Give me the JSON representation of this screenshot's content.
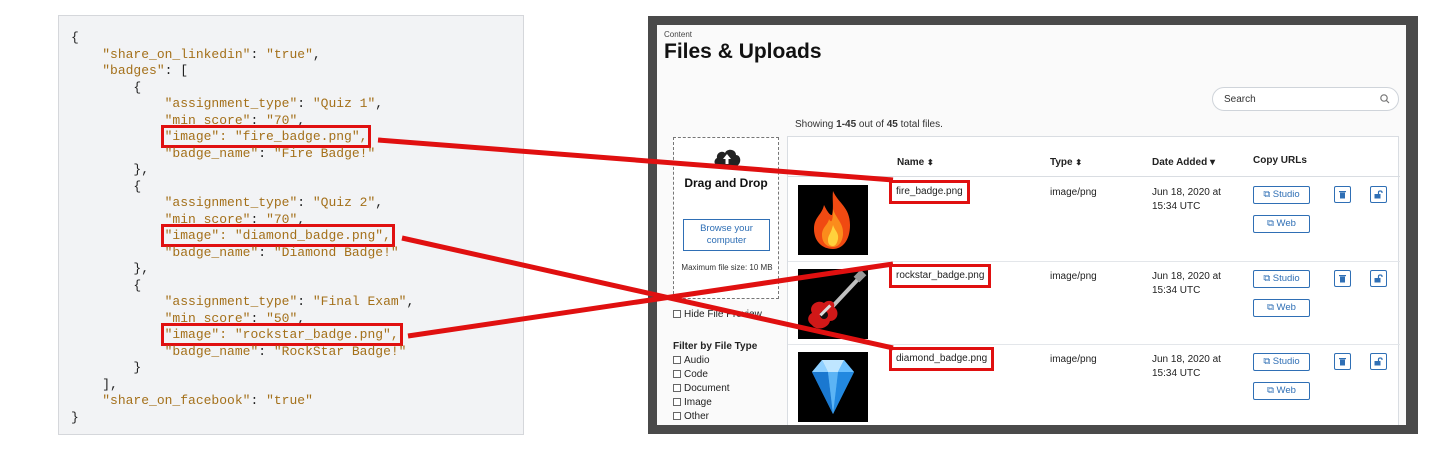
{
  "code": {
    "lines": [
      {
        "segments": [
          {
            "t": "{",
            "c": "p"
          }
        ]
      },
      {
        "segments": [
          {
            "t": "    ",
            "c": "p"
          },
          {
            "t": "\"share_on_linkedin\"",
            "c": "k"
          },
          {
            "t": ": ",
            "c": "p"
          },
          {
            "t": "\"true\"",
            "c": "k"
          },
          {
            "t": ",",
            "c": "p"
          }
        ]
      },
      {
        "segments": [
          {
            "t": "    ",
            "c": "p"
          },
          {
            "t": "\"badges\"",
            "c": "k"
          },
          {
            "t": ": [",
            "c": "p"
          }
        ]
      },
      {
        "segments": [
          {
            "t": "        {",
            "c": "p"
          }
        ]
      },
      {
        "segments": [
          {
            "t": "            ",
            "c": "p"
          },
          {
            "t": "\"assignment_type\"",
            "c": "k"
          },
          {
            "t": ": ",
            "c": "p"
          },
          {
            "t": "\"Quiz 1\"",
            "c": "k"
          },
          {
            "t": ",",
            "c": "p"
          }
        ]
      },
      {
        "segments": [
          {
            "t": "            ",
            "c": "p"
          },
          {
            "t": "\"min_score\"",
            "c": "k"
          },
          {
            "t": ": ",
            "c": "p"
          },
          {
            "t": "\"70\"",
            "c": "k"
          },
          {
            "t": ",",
            "c": "p"
          }
        ]
      },
      {
        "segments": [
          {
            "t": "            ",
            "c": "p"
          },
          {
            "t": "\"image\": \"fire_badge.png\",",
            "c": "k",
            "hl": true
          }
        ]
      },
      {
        "segments": [
          {
            "t": "            ",
            "c": "p"
          },
          {
            "t": "\"badge_name\"",
            "c": "k"
          },
          {
            "t": ": ",
            "c": "p"
          },
          {
            "t": "\"Fire Badge!\"",
            "c": "k"
          }
        ]
      },
      {
        "segments": [
          {
            "t": "        },",
            "c": "p"
          }
        ]
      },
      {
        "segments": [
          {
            "t": "        {",
            "c": "p"
          }
        ]
      },
      {
        "segments": [
          {
            "t": "            ",
            "c": "p"
          },
          {
            "t": "\"assignment_type\"",
            "c": "k"
          },
          {
            "t": ": ",
            "c": "p"
          },
          {
            "t": "\"Quiz 2\"",
            "c": "k"
          },
          {
            "t": ",",
            "c": "p"
          }
        ]
      },
      {
        "segments": [
          {
            "t": "            ",
            "c": "p"
          },
          {
            "t": "\"min_score\"",
            "c": "k"
          },
          {
            "t": ": ",
            "c": "p"
          },
          {
            "t": "\"70\"",
            "c": "k"
          },
          {
            "t": ",",
            "c": "p"
          }
        ]
      },
      {
        "segments": [
          {
            "t": "            ",
            "c": "p"
          },
          {
            "t": "\"image\": \"diamond_badge.png\",",
            "c": "k",
            "hl": true
          }
        ]
      },
      {
        "segments": [
          {
            "t": "            ",
            "c": "p"
          },
          {
            "t": "\"badge_name\"",
            "c": "k"
          },
          {
            "t": ": ",
            "c": "p"
          },
          {
            "t": "\"Diamond Badge!\"",
            "c": "k"
          }
        ]
      },
      {
        "segments": [
          {
            "t": "        },",
            "c": "p"
          }
        ]
      },
      {
        "segments": [
          {
            "t": "        {",
            "c": "p"
          }
        ]
      },
      {
        "segments": [
          {
            "t": "            ",
            "c": "p"
          },
          {
            "t": "\"assignment_type\"",
            "c": "k"
          },
          {
            "t": ": ",
            "c": "p"
          },
          {
            "t": "\"Final Exam\"",
            "c": "k"
          },
          {
            "t": ",",
            "c": "p"
          }
        ]
      },
      {
        "segments": [
          {
            "t": "            ",
            "c": "p"
          },
          {
            "t": "\"min_score\"",
            "c": "k"
          },
          {
            "t": ": ",
            "c": "p"
          },
          {
            "t": "\"50\"",
            "c": "k"
          },
          {
            "t": ",",
            "c": "p"
          }
        ]
      },
      {
        "segments": [
          {
            "t": "            ",
            "c": "p"
          },
          {
            "t": "\"image\": \"rockstar_badge.png\",",
            "c": "k",
            "hl": true
          }
        ]
      },
      {
        "segments": [
          {
            "t": "            ",
            "c": "p"
          },
          {
            "t": "\"badge_name\"",
            "c": "k"
          },
          {
            "t": ": ",
            "c": "p"
          },
          {
            "t": "\"RockStar Badge!\"",
            "c": "k"
          }
        ]
      },
      {
        "segments": [
          {
            "t": "        }",
            "c": "p"
          }
        ]
      },
      {
        "segments": [
          {
            "t": "    ],",
            "c": "p"
          }
        ]
      },
      {
        "segments": [
          {
            "t": "    ",
            "c": "p"
          },
          {
            "t": "\"share_on_facebook\"",
            "c": "k"
          },
          {
            "t": ": ",
            "c": "p"
          },
          {
            "t": "\"true\"",
            "c": "k"
          }
        ]
      },
      {
        "segments": [
          {
            "t": "}",
            "c": "p"
          }
        ]
      }
    ]
  },
  "app": {
    "breadcrumb": "Content",
    "title": "Files & Uploads",
    "search_placeholder": "Search",
    "showing": {
      "prefix": "Showing ",
      "range": "1-45",
      "mid": " out of ",
      "total": "45",
      "suffix": " total files."
    },
    "upload": {
      "title": "Drag and Drop",
      "browse": "Browse your computer",
      "max_size": "Maximum file size: 10 MB"
    },
    "hide_preview": "Hide File Preview",
    "filter": {
      "title": "Filter by File Type",
      "options": [
        "Audio",
        "Code",
        "Document",
        "Image",
        "Other"
      ]
    },
    "table": {
      "columns": [
        "Name",
        "Type",
        "Date Added",
        "Copy URLs"
      ],
      "sort_icons": [
        "updown",
        "updown",
        "down"
      ],
      "studio_label": "Studio",
      "web_label": "Web",
      "rows": [
        {
          "name": "fire_badge.png",
          "type": "image/png",
          "date_line1": "Jun 18, 2020 at",
          "date_line2": "15:34 UTC",
          "thumb": "fire-badge"
        },
        {
          "name": "rockstar_badge.png",
          "type": "image/png",
          "date_line1": "Jun 18, 2020 at",
          "date_line2": "15:34 UTC",
          "thumb": "guitar-badge"
        },
        {
          "name": "diamond_badge.png",
          "type": "image/png",
          "date_line1": "Jun 18, 2020 at",
          "date_line2": "15:34 UTC",
          "thumb": "diamond-badge"
        }
      ]
    }
  },
  "colors": {
    "highlight": "#e01010",
    "json_key": "#a4701a",
    "link_blue": "#2f6fb5",
    "frame": "#4a4a4a"
  }
}
